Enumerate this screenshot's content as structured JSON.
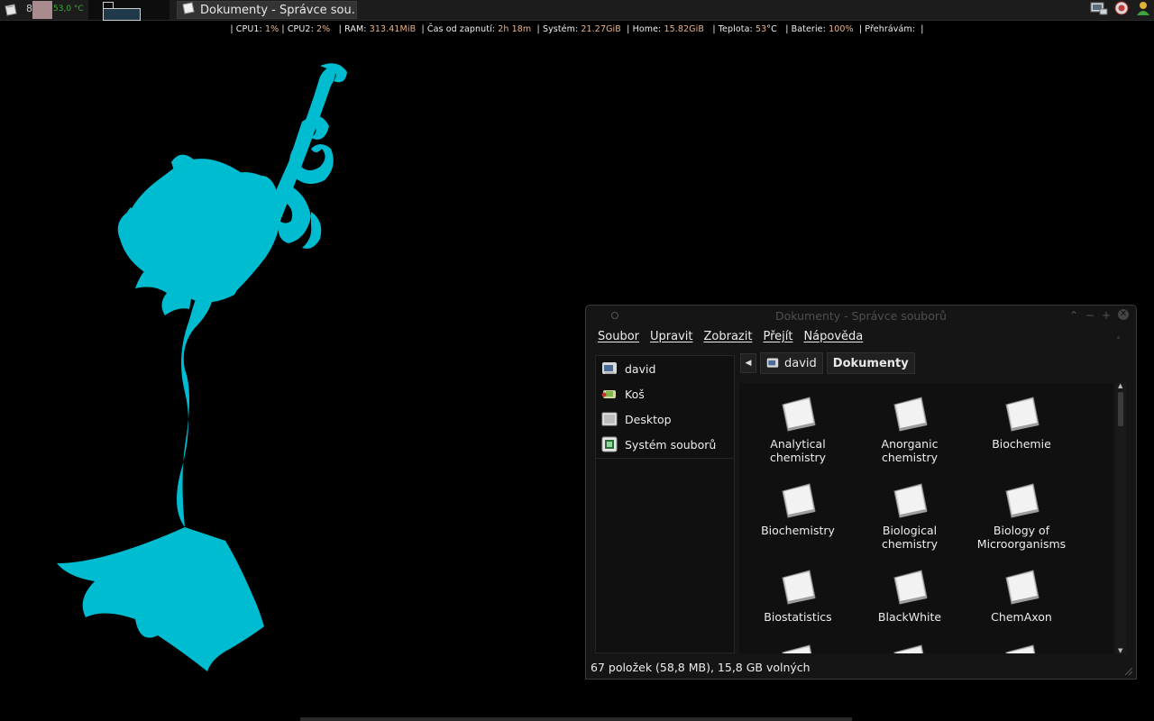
{
  "panel": {
    "workspace_number": "8",
    "temperature": "53,0 °C",
    "task_title": "Dokumenty - Správce sou..."
  },
  "stats": {
    "cpu1_label": "CPU1:",
    "cpu1": "1%",
    "cpu2_label": "CPU2:",
    "cpu2": "2%",
    "ram_label": "RAM:",
    "ram": "313.41MiB",
    "uptime_label": "Čas od zapnutí:",
    "uptime": "2h 18m",
    "system_label": "Systém:",
    "system": "21.27GiB",
    "home_label": "Home:",
    "home": "15.82GiB",
    "temp_label": "Teplota:",
    "temp": "53",
    "temp_unit": "°C",
    "battery_label": "Baterie:",
    "battery": "100%",
    "playing_label": "Přehrávám:"
  },
  "colors": {
    "wallpaper_figure": "#00bcd0",
    "stats_value": "#e8b389",
    "temp_green": "#2bb52b",
    "cpu_graph": "#a98a8e"
  },
  "window": {
    "title": "Dokumenty - Správce souborů",
    "menu": [
      "Soubor",
      "Upravit",
      "Zobrazit",
      "Přejít",
      "Nápověda"
    ],
    "sidebar": [
      {
        "label": "david",
        "icon": "home-folder-icon"
      },
      {
        "label": "Koš",
        "icon": "trash-icon"
      },
      {
        "label": "Desktop",
        "icon": "desktop-icon"
      },
      {
        "label": "Systém souborů",
        "icon": "filesystem-icon"
      }
    ],
    "path": {
      "parent": "david",
      "current": "Dokumenty"
    },
    "folders": [
      "Analytical chemistry",
      "Anorganic chemistry",
      "Biochemie",
      "Biochemistry",
      "Biological chemistry",
      "Biology of Microorganisms",
      "Biostatistics",
      "BlackWhite",
      "ChemAxon",
      "",
      "",
      ""
    ],
    "status": "67 položek (58,8 MB), 15,8 GB volných"
  }
}
